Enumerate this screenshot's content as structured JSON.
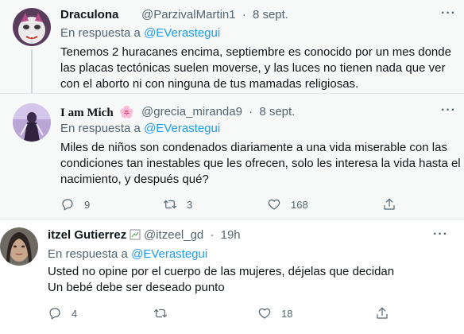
{
  "tweets": [
    {
      "name": "Draculona",
      "handle": "@ParzivalMartin1",
      "dot": "·",
      "date": "8 sept.",
      "reply_prefix": "En respuesta a ",
      "reply_to": "@EVerastegui",
      "lines": [
        "Tenemos 2 huracanes encima, septiembre es conocido por un mes donde",
        "las placas tectónicas suelen moverse, y las luces no tienen nada que ver",
        "con el aborto ni con ninguna de tus mamadas religiosas."
      ]
    },
    {
      "name": "I am Mich",
      "name_emoji": "🌸",
      "handle": "@grecia_miranda9",
      "dot": "·",
      "date": "8 sept.",
      "reply_prefix": "En respuesta a ",
      "reply_to": "@EVerastegui",
      "lines": [
        "Miles de niños son condenados diariamente a una vida miserable con las",
        "condiciones tan inestables que les ofrecen, solo les interesa la vida hasta el",
        "nacimiento, y después qué?"
      ],
      "replies": "9",
      "retweets": "3",
      "likes": "168"
    },
    {
      "name": "itzel Gutierrez",
      "handle": "@itzeel_gd",
      "dot": "·",
      "date": "19h",
      "reply_prefix": "En respuesta a ",
      "reply_to": "@EVerastegui",
      "lines": [
        "Usted no opine por el cuerpo de las mujeres, déjelas que decidan",
        "Un bebé debe ser deseado punto"
      ],
      "replies": "4",
      "retweets": "",
      "likes": "18"
    }
  ],
  "more_label": "···",
  "colors": {
    "accent": "#1d9bf0",
    "muted": "#536471",
    "text": "#0f1419",
    "bg_highlight": "#f7f9f9"
  }
}
